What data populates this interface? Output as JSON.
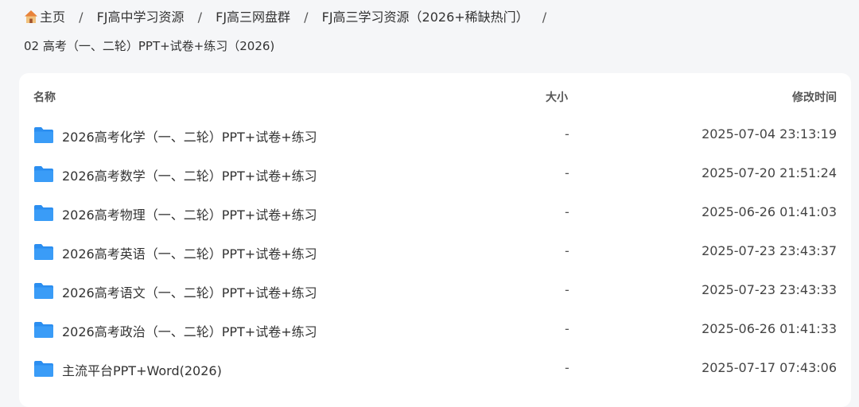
{
  "breadcrumb": {
    "items": [
      {
        "label": "主页"
      },
      {
        "label": "FJ高中学习资源"
      },
      {
        "label": "FJ高三网盘群"
      },
      {
        "label": "FJ高三学习资源（2026+稀缺热门）"
      },
      {
        "label": "02 高考（一、二轮）PPT+试卷+练习（2026)"
      }
    ],
    "separator": "/"
  },
  "table": {
    "headers": {
      "name": "名称",
      "size": "大小",
      "time": "修改时间"
    },
    "rows": [
      {
        "name": "2026高考化学（一、二轮）PPT+试卷+练习",
        "size": "-",
        "time": "2025-07-04 23:13:19"
      },
      {
        "name": "2026高考数学（一、二轮）PPT+试卷+练习",
        "size": "-",
        "time": "2025-07-20 21:51:24"
      },
      {
        "name": "2026高考物理（一、二轮）PPT+试卷+练习",
        "size": "-",
        "time": "2025-06-26 01:41:03"
      },
      {
        "name": "2026高考英语（一、二轮）PPT+试卷+练习",
        "size": "-",
        "time": "2025-07-23 23:43:37"
      },
      {
        "name": "2026高考语文（一、二轮）PPT+试卷+练习",
        "size": "-",
        "time": "2025-07-23 23:43:33"
      },
      {
        "name": "2026高考政治（一、二轮）PPT+试卷+练习",
        "size": "-",
        "time": "2025-06-26 01:41:33"
      },
      {
        "name": "主流平台PPT+Word(2026)",
        "size": "-",
        "time": "2025-07-17 07:43:06"
      }
    ]
  },
  "icons": {
    "home": "home-icon",
    "folder": "folder-icon"
  },
  "colors": {
    "folder": "#2b8ef0",
    "background": "#f5f6f8",
    "card": "#ffffff"
  }
}
